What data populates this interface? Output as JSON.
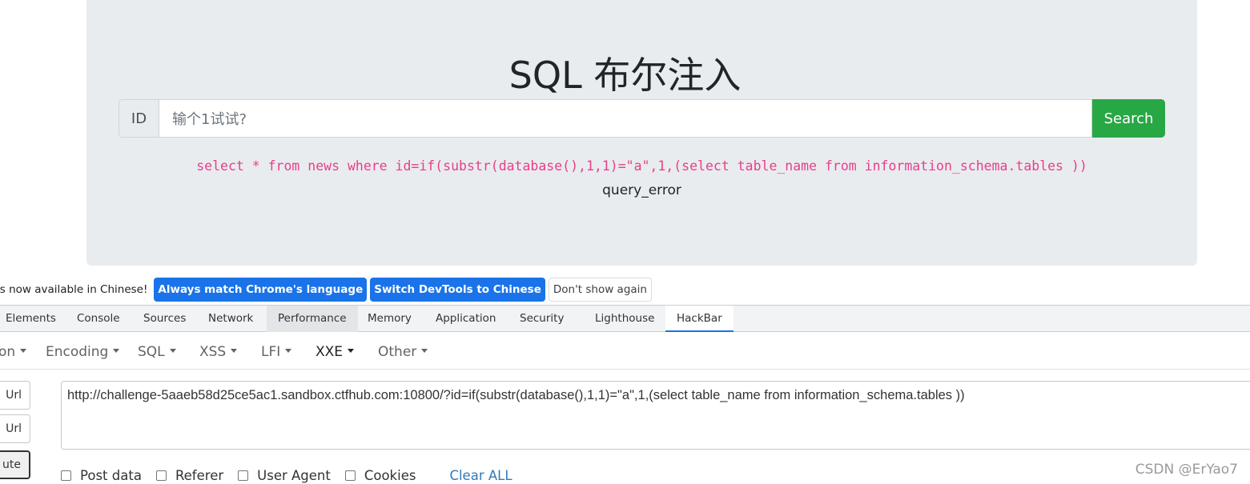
{
  "page": {
    "title": "SQL 布尔注入",
    "id_label": "ID",
    "id_placeholder": "输个1试试?",
    "search_button": "Search",
    "sql_statement": "select * from news where id=if(substr(database(),1,1)=\"a\",1,(select table_name from information_schema.tables ))",
    "result_text": "query_error"
  },
  "devtools": {
    "infobar": {
      "message": "is now available in Chinese!",
      "buttons": [
        "Always match Chrome's language",
        "Switch DevTools to Chinese",
        "Don't show again"
      ]
    },
    "tabs": [
      "Elements",
      "Console",
      "Sources",
      "Network",
      "Performance",
      "Memory",
      "Application",
      "Security",
      "Lighthouse",
      "HackBar"
    ],
    "hovered_tab": "Performance",
    "active_tab": "HackBar"
  },
  "hackbar": {
    "menu": [
      "on",
      "Encoding",
      "SQL",
      "XSS",
      "LFI",
      "XXE",
      "Other"
    ],
    "side_buttons": [
      "Url",
      "Url",
      "ute"
    ],
    "url_value": "http://challenge-5aaeb58d25ce5ac1.sandbox.ctfhub.com:10800/?id=if(substr(database(),1,1)=\"a\",1,(select table_name from information_schema.tables ))",
    "options": [
      "Post data",
      "Referer",
      "User Agent",
      "Cookies"
    ],
    "clear_all": "Clear ALL"
  },
  "watermark": "CSDN @ErYao7",
  "colors": {
    "jumbotron_bg": "#e9ecef",
    "search_button_bg": "#28a745",
    "sql_text": "#e83e8c",
    "devtools_blue": "#1a73e8",
    "link": "#337ab7"
  }
}
